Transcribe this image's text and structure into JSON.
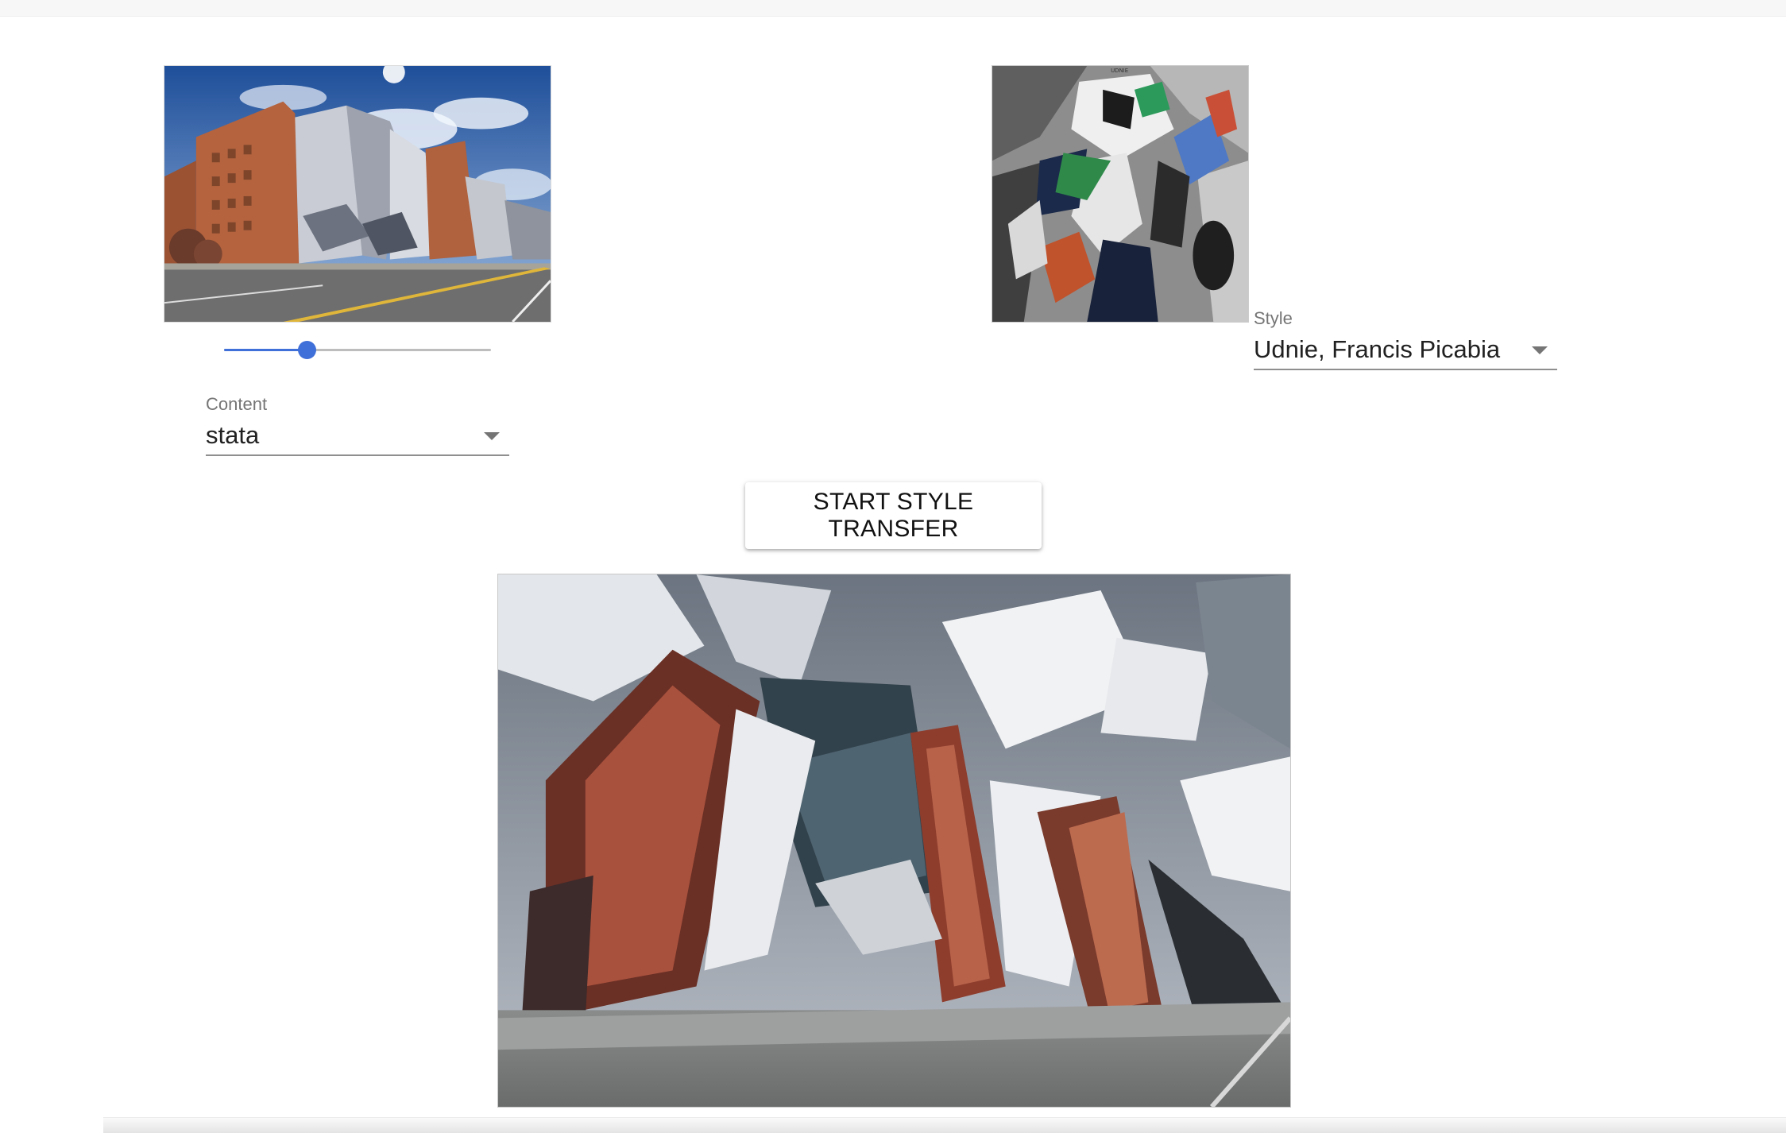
{
  "content": {
    "label": "Content",
    "selected": "stata",
    "image_alt": "Stata Center building content image"
  },
  "style": {
    "label": "Style",
    "selected": "Udnie, Francis Picabia",
    "painting_title": "UDNIE",
    "image_alt": "Udnie, Francis Picabia style painting"
  },
  "style_strength_slider": {
    "value_fraction": 0.31,
    "accent_color": "#3f6fd8"
  },
  "actions": {
    "start_label": "START STYLE TRANSFER"
  },
  "result": {
    "image_alt": "Stylized output image"
  },
  "icons": {
    "dropdown": "chevron-down-icon"
  }
}
